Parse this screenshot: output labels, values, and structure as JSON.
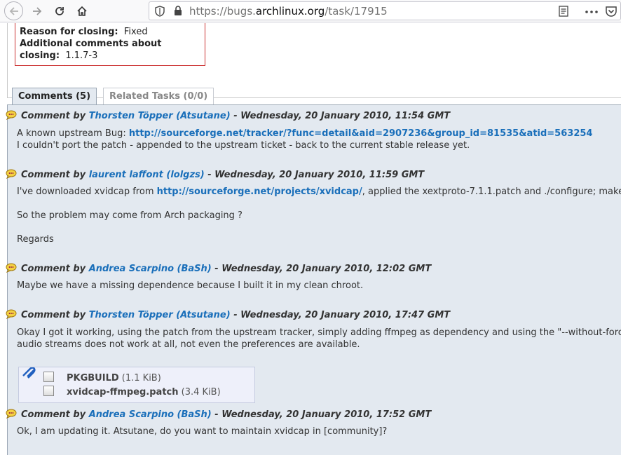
{
  "browser": {
    "url_prefix": "https://bugs.",
    "url_domain": "archlinux.org",
    "url_path": "/task/17915"
  },
  "closing": {
    "reason_label": "Reason for closing:",
    "reason_value": "Fixed",
    "comments_label_1": "Additional comments about",
    "comments_label_2": "closing:",
    "comments_value": "1.1.7-3"
  },
  "tabs": [
    {
      "label": "Comments (5)"
    },
    {
      "label": "Related Tasks (0/0)"
    }
  ],
  "comments": [
    {
      "prefix": "Comment by",
      "author": "Thorsten Töpper (Atsutane)",
      "date": "- Wednesday, 20 January 2010, 11:54 GMT",
      "lines": [
        {
          "text": "A known upstream Bug: ",
          "link": "http://sourceforge.net/tracker/?func=detail&aid=2907236&group_id=81535&atid=563254",
          "after": ""
        },
        {
          "text": "I couldn't port the patch - appended to the upstream ticket - back to the current stable release yet."
        }
      ]
    },
    {
      "prefix": "Comment by",
      "author": "laurent laffont (lolgzs)",
      "date": "- Wednesday, 20 January 2010, 11:59 GMT",
      "lines": [
        {
          "text": "I've downloaded xvidcap from ",
          "link": "http://sourceforge.net/projects/xvidcap/",
          "after": ", applied the xextproto-7.1.1.patch and ./configure; make"
        },
        {
          "text": "So the problem may come from Arch packaging ?"
        },
        {
          "text": "Regards"
        }
      ]
    },
    {
      "prefix": "Comment by",
      "author": "Andrea Scarpino (BaSh)",
      "date": "- Wednesday, 20 January 2010, 12:02 GMT",
      "lines": [
        {
          "text": "Maybe we have a missing dependence because I built it in my clean chroot."
        }
      ]
    },
    {
      "prefix": "Comment by",
      "author": "Thorsten Töpper (Atsutane)",
      "date": "- Wednesday, 20 January 2010, 17:47 GMT",
      "lines": [
        {
          "text": "Okay I got it working, using the patch from the upstream tracker, simply adding ffmpeg as dependency and using the \"--without-forc"
        },
        {
          "text": "audio streams does not work at all, not even the preferences are available."
        }
      ]
    },
    {
      "prefix": "Comment by",
      "author": "Andrea Scarpino (BaSh)",
      "date": "- Wednesday, 20 January 2010, 17:52 GMT",
      "lines": [
        {
          "text": "Ok, I am updating it. Atsutane, do you want to maintain xvidcap in [community]?"
        }
      ]
    }
  ],
  "attachments": [
    {
      "name": "PKGBUILD",
      "size": "(1.1 KiB)"
    },
    {
      "name": "xvidcap-ffmpeg.patch",
      "size": "(3.4 KiB)"
    }
  ]
}
